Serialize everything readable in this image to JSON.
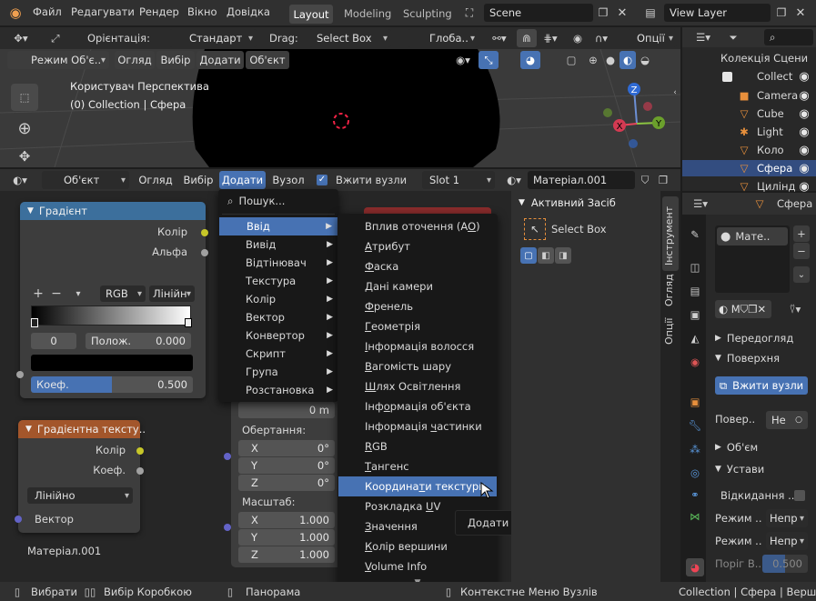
{
  "topbar": {
    "menu": [
      "Файл",
      "Редагувати",
      "Рендер",
      "Вікно",
      "Довідка"
    ],
    "workspaces": [
      "Layout",
      "Modeling",
      "Sculpting"
    ],
    "scene": "Scene",
    "view_layer": "View Layer"
  },
  "toolbar": {
    "orientation_label": "Орієнтація:",
    "orientation_value": "Стандарт",
    "drag_label": "Drag:",
    "drag_value": "Select Box",
    "transform_value": "Глоба..",
    "options": "Опції"
  },
  "viewport_header": {
    "mode": "Режим Об'є..",
    "menu": [
      "Огляд",
      "Вибір",
      "Додати",
      "Об'єкт"
    ]
  },
  "viewport": {
    "title": "Користувач Перспектива",
    "subtitle": "(0) Collection | Сфера"
  },
  "outliner": {
    "root": "Колекція Сцени",
    "collection": "Collect",
    "items": [
      "Camera",
      "Cube",
      "Light",
      "Коло",
      "Сфера",
      "Цилінд"
    ]
  },
  "node_header": {
    "type": "Об'єкт",
    "menu": [
      "Огляд",
      "Вибір",
      "Додати",
      "Вузол"
    ],
    "use_nodes": "Вжити вузли",
    "slot": "Slot 1",
    "material": "Матеріал.001"
  },
  "node_gradient": {
    "title": "Градієнт",
    "out_color": "Колір",
    "out_alpha": "Альфа",
    "mode": "RGB",
    "interp": "Лінійн",
    "index": "0",
    "pos_label": "Полож.",
    "pos_value": "0.000",
    "fac_label": "Коеф.",
    "fac_value": "0.500"
  },
  "node_gradtex": {
    "title": "Градієнтна тексту..",
    "out_color": "Колір",
    "out_fac": "Коеф.",
    "interp": "Лінійно",
    "in_vector": "Вектор"
  },
  "node_mapping": {
    "value_m": "0 m",
    "rotation": "Обертання:",
    "scale": "Масштаб:",
    "rx": "X",
    "ry": "Y",
    "rz": "Z",
    "rv": "0°",
    "sx": "X",
    "sy": "Y",
    "sz": "Z",
    "sv": "1.000"
  },
  "material_label": "Матеріал.001",
  "menu_add": {
    "search": "Пошук...",
    "items": [
      "Ввід",
      "Вивід",
      "Відтінювач",
      "Текстура",
      "Колір",
      "Вектор",
      "Конвертор",
      "Скрипт",
      "Група",
      "Розстановка"
    ]
  },
  "submenu": {
    "items": [
      "Вплив оточення (AO)",
      "Атрибут",
      "Фаска",
      "Дані камери",
      "Френель",
      "Геометрія",
      "Інформація волосся",
      "Вагомість шару",
      "Шлях Освітлення",
      "Інформація об'єкта",
      "Інформація частинки",
      "RGB",
      "Тангенс",
      "Координати текстури",
      "Розкладка UV",
      "Значення",
      "Колір вершини",
      "Volume Info"
    ],
    "underline": [
      "O",
      "А",
      "Ф",
      "Д",
      "Ф",
      "Г",
      "І",
      "В",
      "Ш",
      "о",
      "ч",
      "R",
      "Т",
      "т",
      "U",
      "З",
      "К",
      "V"
    ],
    "highlight_index": 13
  },
  "tooltip": "Додати вузол до активного дерева.",
  "tool_panel": {
    "title": "Активний Засіб",
    "tool": "Select Box",
    "tabs": [
      "Інструмент",
      "Огляд",
      "Опції"
    ]
  },
  "properties": {
    "object": "Сфера",
    "material_slot": "Мате..",
    "preview": "Передогляд",
    "surface": "Поверхня",
    "use_nodes": "Вжити вузли",
    "surface_label": "Повер..",
    "surface_value": "Не",
    "volume": "Об'єм",
    "settings": "Устави",
    "backface": "Відкидання ..",
    "blend_label": "Режим ..",
    "blend_value": "Непр",
    "shadow_label": "Режим ..",
    "shadow_value": "Непр",
    "threshold_label": "Поріг В..",
    "threshold_value": "0.500"
  },
  "statusbar": {
    "select": "Вибрати",
    "box": "Вибір Коробкою",
    "pan": "Панорама",
    "context": "Контекстне Меню Вузлів",
    "info": "Collection | Сфера | Вершини"
  },
  "colors": {
    "accent": "#4772b3",
    "gradient_header": "#3c6f9c",
    "texture_header": "#a3562b",
    "socket_yellow": "#c7c729",
    "socket_gray": "#a1a1a1",
    "socket_purple": "#6363c7"
  }
}
